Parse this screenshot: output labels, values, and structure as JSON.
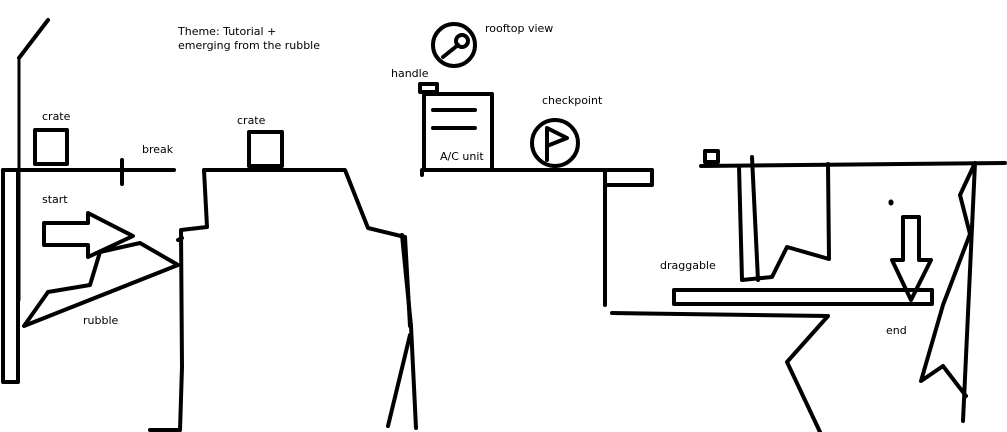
{
  "canvas": {
    "background": "#ffffff",
    "ink_color": "#000000"
  },
  "labels": {
    "theme_line1": "Theme: Tutorial +",
    "theme_line2": "emerging from the rubble",
    "crate_left": "crate",
    "break": "break",
    "start": "start",
    "rubble": "rubble",
    "crate_middle": "crate",
    "handle": "handle",
    "rooftop_view": "rooftop view",
    "ac_unit": "A/C unit",
    "checkpoint": "checkpoint",
    "draggable": "draggable",
    "end": "end"
  },
  "icons": {
    "rooftop_view": "key-icon",
    "checkpoint": "flag-icon"
  }
}
